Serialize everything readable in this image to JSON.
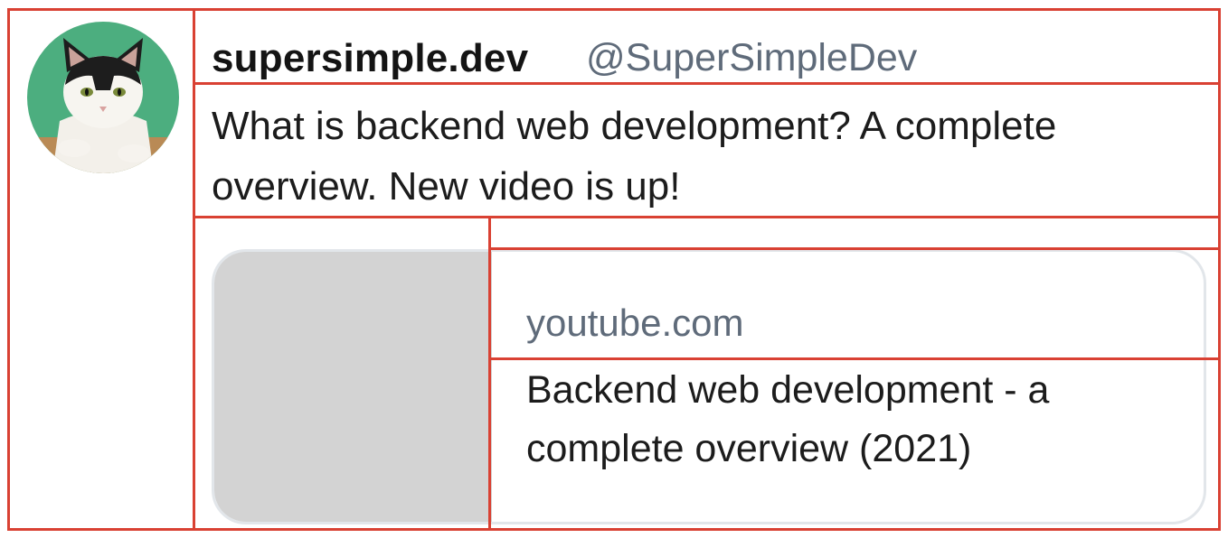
{
  "tweet": {
    "author_name": "supersimple.dev",
    "author_handle": "@SuperSimpleDev",
    "text": "What is backend web development? A complete overview. New video is up!",
    "avatar_icon": "cat-avatar-icon",
    "preview": {
      "domain": "youtube.com",
      "title": "Backend web development - a complete overview (2021)",
      "thumbnail_color": "#d3d3d3"
    }
  },
  "colors": {
    "outline": "#d94133",
    "handle": "#5f6b7a",
    "card_border": "#e2e6ea",
    "avatar_bg": "#4cae7f"
  }
}
